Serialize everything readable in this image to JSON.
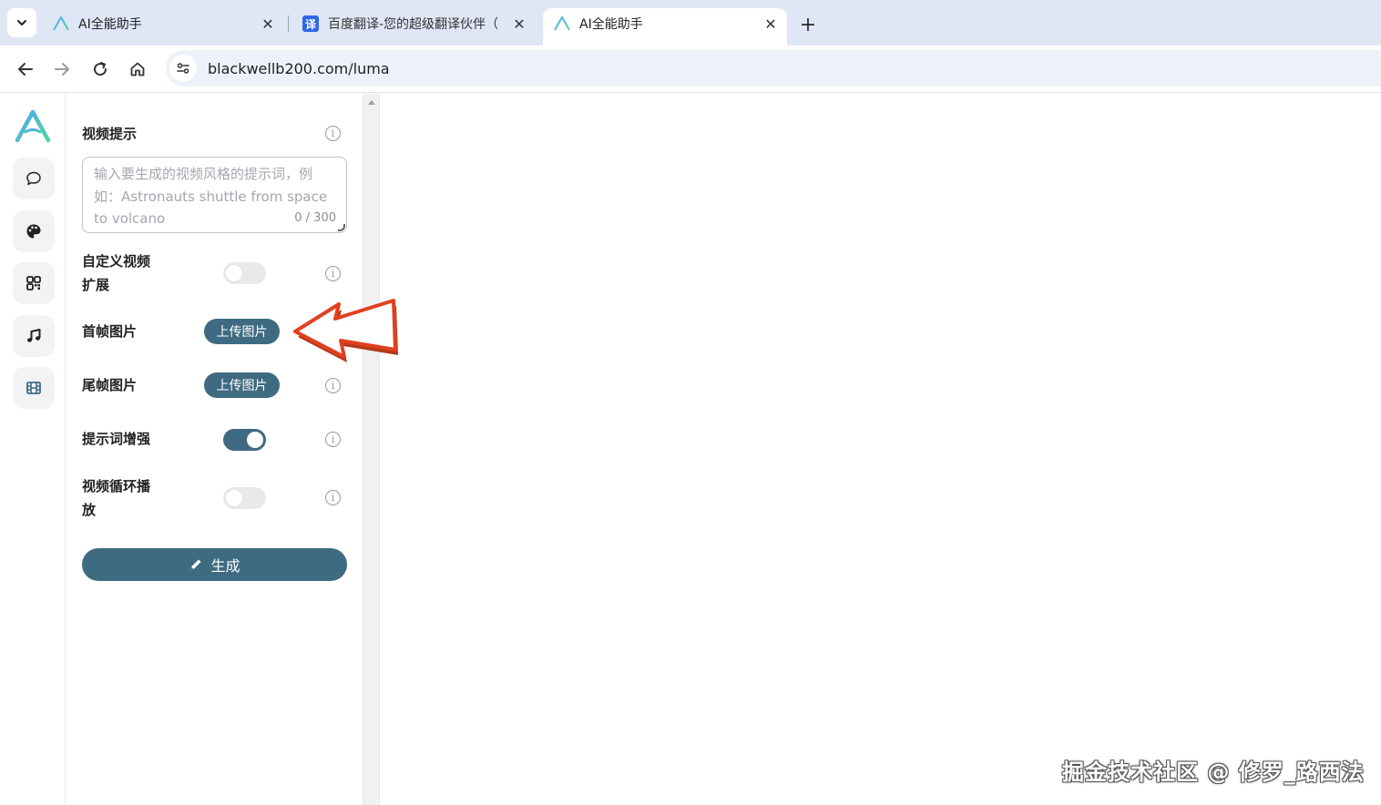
{
  "browser": {
    "tabs": [
      {
        "title": "AI全能助手",
        "active": false,
        "favicon": "luma-logo-icon"
      },
      {
        "title": "百度翻译-您的超级翻译伙伴（",
        "active": false,
        "favicon": "baidu-translate-icon",
        "favicon_text": "译"
      },
      {
        "title": "AI全能助手",
        "active": true,
        "favicon": "luma-logo-icon"
      }
    ],
    "url": "blackwellb200.com/luma"
  },
  "panel": {
    "video_prompt_label": "视频提示",
    "prompt_placeholder": "输入要生成的视频风格的提示词，例如：Astronauts shuttle from space to volcano",
    "prompt_counter": "0 / 300",
    "custom_extend_label_line1": "自定义视频",
    "custom_extend_label_line2": "扩展",
    "first_frame_label": "首帧图片",
    "upload_label": "上传图片",
    "last_frame_label": "尾帧图片",
    "prompt_enhance_label": "提示词增强",
    "loop_label_line1": "视频循环播",
    "loop_label_line2": "放",
    "generate_label": "生成",
    "toggles": {
      "custom_extend": false,
      "prompt_enhance": true,
      "loop": false
    }
  },
  "watermark": "掘金技术社区 @ 修罗_路西法",
  "colors": {
    "accent": "#3f6b82",
    "tabstrip": "#dfe6f5",
    "omnibox": "#edf2fa",
    "annotation_arrow": "#e2401f"
  }
}
